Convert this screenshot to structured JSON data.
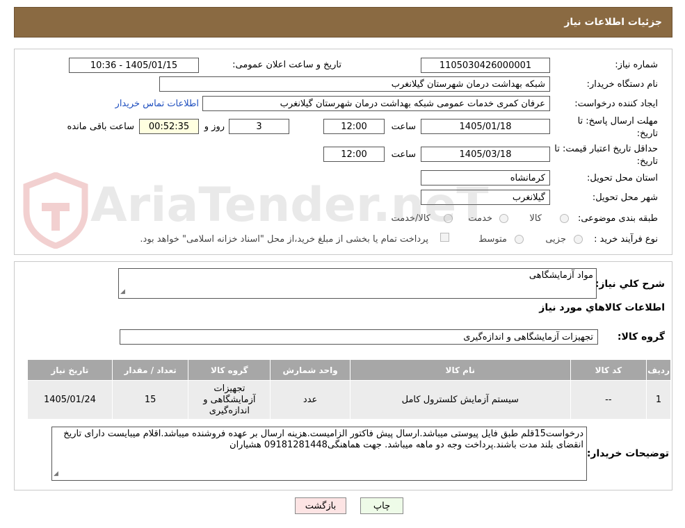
{
  "header": {
    "title": "جزئیات اطلاعات نیاز"
  },
  "form": {
    "need_number_label": "شماره نیاز:",
    "need_number": "1105030426000001",
    "announce_label": "تاریخ و ساعت اعلان عمومی:",
    "announce_value": "1405/01/15 - 10:36",
    "buyer_label": "نام دستگاه خریدار:",
    "buyer_value": "شبکه بهداشت درمان شهرستان گیلانغرب",
    "creator_label": "ایجاد کننده درخواست:",
    "creator_value": "عرفان کمری خدمات عمومی شبکه بهداشت درمان شهرستان گیلانغرب",
    "contact_link": "اطلاعات تماس خریدار",
    "deadline_label": "مهلت ارسال پاسخ: تا تاریخ:",
    "deadline_date": "1405/01/18",
    "time_label": "ساعت",
    "deadline_time": "12:00",
    "days_value": "3",
    "days_label": "روز و",
    "remaining_value": "00:52:35",
    "remaining_label": "ساعت باقی مانده",
    "validity_label": "حداقل تاریخ اعتبار قیمت: تا تاریخ:",
    "validity_date": "1405/03/18",
    "validity_time": "12:00",
    "province_label": "استان محل تحویل:",
    "province_value": "کرمانشاه",
    "city_label": "شهر محل تحویل:",
    "city_value": "گیلانغرب",
    "category_label": "طبقه بندی موضوعی:",
    "category_options": [
      "کالا",
      "خدمت",
      "کالا/خدمت"
    ],
    "process_label": "نوع فرآیند خرید :",
    "process_options": [
      "جزیی",
      "متوسط"
    ],
    "payment_note": "پرداخت تمام یا بخشی از مبلغ خرید،از محل \"اسناد خزانه اسلامی\" خواهد بود."
  },
  "details": {
    "summary_label": "شرح کلي نیاز:",
    "summary_value": "مواد آزمایشگاهی",
    "goods_info_title": "اطلاعات کالاهاي مورد نیاز",
    "group_label": "گروه کالا:",
    "group_value": "تجهیزات آزمایشگاهی و اندازه‌گیری",
    "table": {
      "headers": [
        "ردیف",
        "کد کالا",
        "نام کالا",
        "واحد شمارش",
        "گروه کالا",
        "تعداد / مقدار",
        "تاریخ نیاز"
      ],
      "rows": [
        [
          "1",
          "--",
          "سیستم آزمایش کلسترول کامل",
          "عدد",
          "تجهیزات آزمایشگاهی و اندازه‌گیری",
          "15",
          "1405/01/24"
        ]
      ]
    },
    "buyer_notes_label": "توضیحات خریدار:",
    "buyer_notes_value": "درخواست15قلم طبق فایل پیوستی میباشد.ارسال پیش فاکتور الزامیست.هزینه ارسال بر عهده فروشنده میباشد.اقلام میبایست دارای تاریخ انقضای بلند مدت باشند.پرداخت وجه دو ماهه میباشد. جهت هماهنگی09181281448 هشیاران"
  },
  "buttons": {
    "print": "چاپ",
    "back": "بازگشت"
  },
  "watermark": {
    "text": "AriaTender.neT"
  }
}
